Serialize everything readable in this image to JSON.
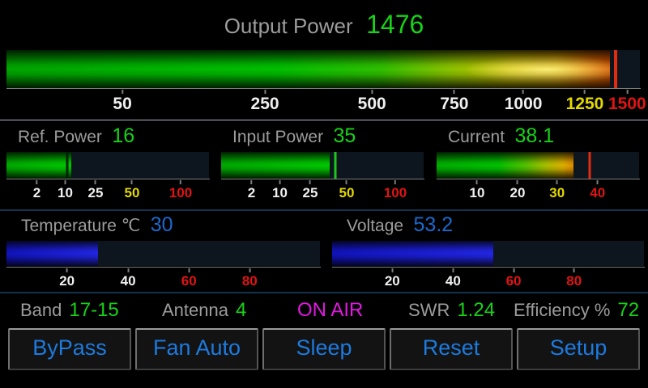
{
  "output_gauge": {
    "label": "Output Power",
    "value": "1476",
    "fill_pct": 95.3,
    "marker_pct": 96.2,
    "marker_color": "#e22c10",
    "ticks": [
      {
        "label": "50",
        "pct": 18.3,
        "color": "#f0f0f0"
      },
      {
        "label": "250",
        "pct": 40.8,
        "color": "#f0f0f0"
      },
      {
        "label": "500",
        "pct": 57.7,
        "color": "#f0f0f0"
      },
      {
        "label": "750",
        "pct": 70.7,
        "color": "#f0f0f0"
      },
      {
        "label": "1000",
        "pct": 81.6,
        "color": "#f0f0f0"
      },
      {
        "label": "1250",
        "pct": 91.3,
        "color": "#e3d800"
      },
      {
        "label": "1500",
        "pct": 98.0,
        "color": "#e01414"
      }
    ]
  },
  "mid_gauges": [
    {
      "label": "Ref. Power",
      "value": "16",
      "fill_pct": 32,
      "marker_pct": 30,
      "marker_color": "#03200a",
      "ticks": [
        {
          "label": "2",
          "pct": 15,
          "color": "#f0f0f0"
        },
        {
          "label": "10",
          "pct": 29,
          "color": "#f0f0f0"
        },
        {
          "label": "25",
          "pct": 44,
          "color": "#f0f0f0"
        },
        {
          "label": "50",
          "pct": 62,
          "color": "#e3d800"
        },
        {
          "label": "100",
          "pct": 86,
          "color": "#e01414"
        }
      ]
    },
    {
      "label": "Input Power",
      "value": "35",
      "fill_pct": 53.5,
      "marker_pct": 56.5,
      "marker_color": "#1dc81d",
      "ticks": [
        {
          "label": "2",
          "pct": 15,
          "color": "#f0f0f0"
        },
        {
          "label": "10",
          "pct": 29,
          "color": "#f0f0f0"
        },
        {
          "label": "25",
          "pct": 44,
          "color": "#f0f0f0"
        },
        {
          "label": "50",
          "pct": 62,
          "color": "#e3d800"
        },
        {
          "label": "100",
          "pct": 86,
          "color": "#e01414"
        }
      ]
    },
    {
      "label": "Current",
      "value": "38.1",
      "fill_pct": 67.5,
      "marker_pct": 75.5,
      "marker_color": "#e22c10",
      "ticks": [
        {
          "label": "10",
          "pct": 20,
          "color": "#f0f0f0"
        },
        {
          "label": "20",
          "pct": 40,
          "color": "#f0f0f0"
        },
        {
          "label": "30",
          "pct": 59.5,
          "color": "#e3d800"
        },
        {
          "label": "40",
          "pct": 79.5,
          "color": "#e01414"
        }
      ]
    }
  ],
  "bottom_gauges": [
    {
      "label": "Temperature ℃",
      "value": "30",
      "fill_pct": 29.3,
      "ticks": [
        {
          "label": "20",
          "pct": 19.3,
          "color": "#f0f0f0"
        },
        {
          "label": "40",
          "pct": 38.8,
          "color": "#f0f0f0"
        },
        {
          "label": "60",
          "pct": 58.2,
          "color": "#e01414"
        },
        {
          "label": "80",
          "pct": 77.6,
          "color": "#e01414"
        }
      ]
    },
    {
      "label": "Voltage",
      "value": "53.2",
      "fill_pct": 51.7,
      "ticks": [
        {
          "label": "20",
          "pct": 19.3,
          "color": "#f0f0f0"
        },
        {
          "label": "40",
          "pct": 38.8,
          "color": "#f0f0f0"
        },
        {
          "label": "60",
          "pct": 58.2,
          "color": "#e01414"
        },
        {
          "label": "80",
          "pct": 77.6,
          "color": "#e01414"
        }
      ]
    }
  ],
  "status": [
    {
      "label": "Band",
      "value": "17-15"
    },
    {
      "label": "Antenna",
      "value": "4"
    },
    {
      "label": "",
      "value": "ON AIR"
    },
    {
      "label": "SWR",
      "value": "1.24"
    },
    {
      "label": "Efficiency %",
      "value": "72"
    }
  ],
  "buttons": [
    {
      "label": "ByPass"
    },
    {
      "label": "Fan Auto"
    },
    {
      "label": "Sleep"
    },
    {
      "label": "Reset"
    },
    {
      "label": "Setup"
    }
  ],
  "colors": {
    "green_value": "#17d317",
    "blue_value": "#1a6ad0",
    "gray_label": "#9c9c9c",
    "on_air_magenta": "#e318e3",
    "button_text_blue": "#1d7adf",
    "tick_yellow": "#e3d800",
    "tick_red": "#e01414",
    "track_dark": "#0d151e"
  }
}
